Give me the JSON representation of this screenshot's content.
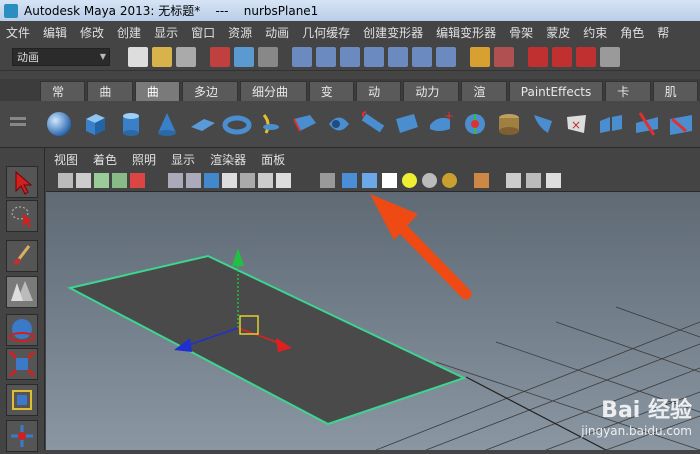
{
  "window": {
    "title": "Autodesk Maya 2013: 无标题*    ---    nurbsPlane1"
  },
  "menubar": {
    "items": [
      "文件",
      "编辑",
      "修改",
      "创建",
      "显示",
      "窗口",
      "资源",
      "动画",
      "几何缓存",
      "创建变形器",
      "编辑变形器",
      "骨架",
      "蒙皮",
      "约束",
      "角色",
      "帮"
    ]
  },
  "statusline": {
    "mode": "动画"
  },
  "shelf": {
    "tabs": [
      "常规",
      "曲线",
      "曲面",
      "多边形",
      "细分曲面",
      "变形",
      "动画",
      "动力学",
      "渲染",
      "PaintEffects",
      "卡通",
      "肌肉"
    ],
    "active_tab": "曲面"
  },
  "panel_menu": {
    "items": [
      "视图",
      "着色",
      "照明",
      "显示",
      "渲染器",
      "面板"
    ]
  },
  "watermark": {
    "brand": "Bai 经验",
    "url": "jingyan.baidu.com"
  },
  "colors": {
    "menu_bg": "#444444",
    "viewport_top": "#5f6a75",
    "viewport_bottom": "#8a96a2",
    "plane_fill": "#4a4a4a",
    "plane_edge": "#3cd690",
    "axis_x": "#e02020",
    "axis_y": "#20c040",
    "axis_z": "#2030d0",
    "annotation_arrow": "#f04a14"
  }
}
